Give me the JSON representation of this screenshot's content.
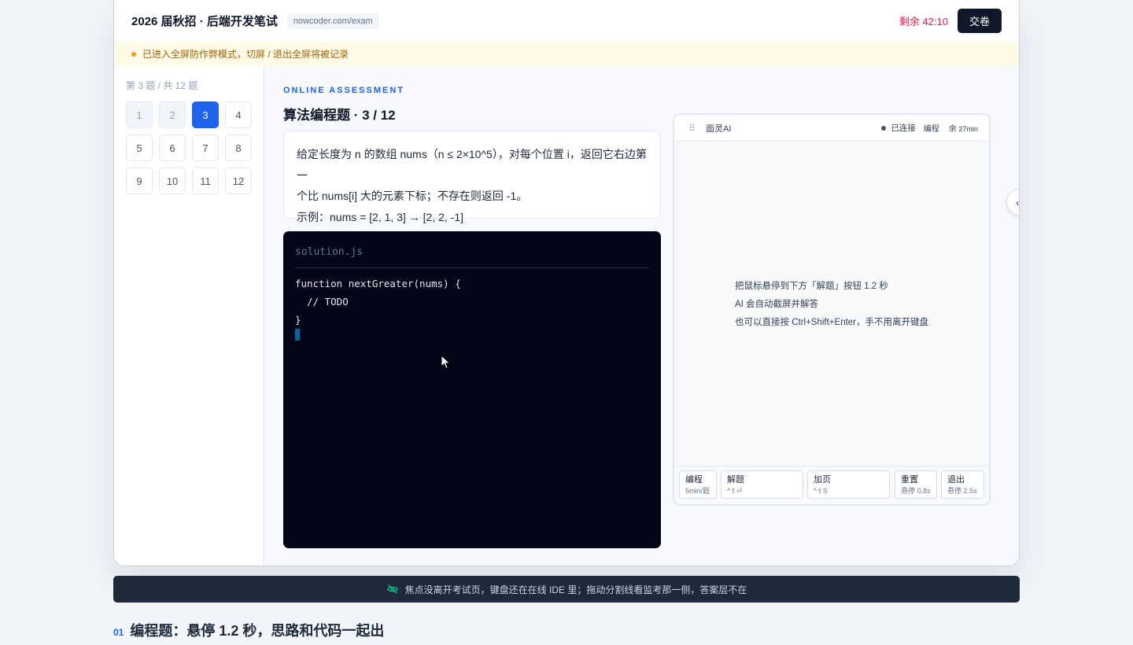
{
  "header": {
    "title": "2026 届秋招 · 后端开发笔试",
    "url": "nowcoder.com/exam",
    "timer": "剩余 42:10",
    "submit_label": "交卷"
  },
  "warning": "已进入全屏防作弊模式，切屏 / 退出全屏将被记录",
  "sidebar": {
    "progress": "第 3 题 / 共 12 题",
    "questions": [
      {
        "label": "1",
        "state": "done"
      },
      {
        "label": "2",
        "state": "done"
      },
      {
        "label": "3",
        "state": "active"
      },
      {
        "label": "4",
        "state": "todo"
      },
      {
        "label": "5",
        "state": "todo"
      },
      {
        "label": "6",
        "state": "todo"
      },
      {
        "label": "7",
        "state": "todo"
      },
      {
        "label": "8",
        "state": "todo"
      },
      {
        "label": "9",
        "state": "todo"
      },
      {
        "label": "10",
        "state": "todo"
      },
      {
        "label": "11",
        "state": "todo"
      },
      {
        "label": "12",
        "state": "todo"
      }
    ]
  },
  "question": {
    "eyebrow": "ONLINE ASSESSMENT",
    "title": "算法编程题 · 3 / 12",
    "line1": "给定长度为 n 的数组 nums（n ≤ 2×10^5），对每个位置 i，返回它右边第一",
    "line2": "个比 nums[i] 大的元素下标；不存在则返回 -1。",
    "example": "示例：nums = [2, 1, 3] → [2, 2, -1]"
  },
  "editor": {
    "filename": "solution.js",
    "code": "function nextGreater(nums) {\n  // TODO\n}"
  },
  "ai_panel": {
    "name": "面灵AI",
    "status": "已连接",
    "mode": "编程",
    "remain_prefix": "余",
    "remain_value": "27min",
    "hint1": "把鼠标悬停到下方「解题」按钮 1.2 秒",
    "hint2": "AI 会自动截屏并解答",
    "hint3": "也可以直接按 Ctrl+Shift+Enter，手不用离开键盘",
    "buttons": [
      {
        "label": "编程",
        "sub": "5min/题"
      },
      {
        "label": "解题",
        "sub": "^⇧⏎"
      },
      {
        "label": "加页",
        "sub": "^⇧S"
      },
      {
        "label": "重置",
        "sub": "悬停 0.8s"
      },
      {
        "label": "退出",
        "sub": "悬停 2.5s"
      }
    ]
  },
  "side_handle": "‹",
  "status_bar": "焦点没离开考试页，键盘还在在线 IDE 里；拖动分割线看监考那一侧，答案层不在",
  "section": {
    "number": "01",
    "title": "编程题：悬停 1.2 秒，思路和代码一起出"
  }
}
